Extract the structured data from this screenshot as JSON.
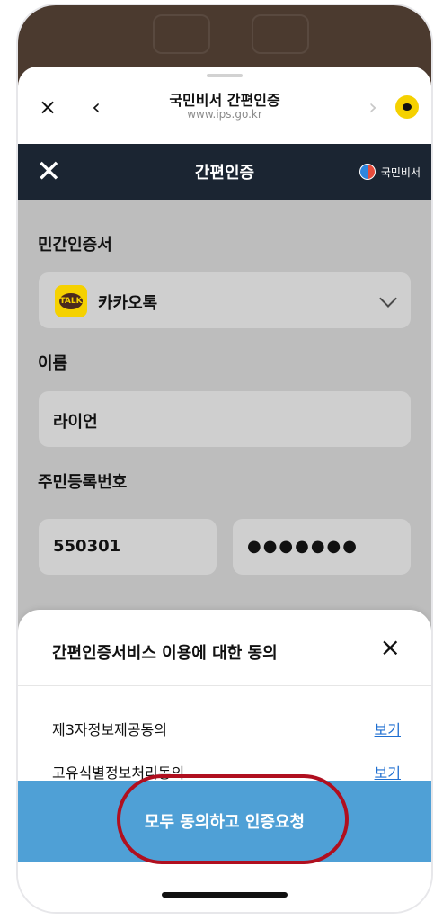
{
  "browser": {
    "close": "×",
    "back": "‹",
    "forward": "›",
    "title": "국민비서 간편인증",
    "url": "www.ips.go.kr"
  },
  "navbar": {
    "close": "✕",
    "title": "간편인증",
    "brand": "국민비서"
  },
  "form": {
    "cert_label": "민간인증서",
    "cert_value": "카카오톡",
    "name_label": "이름",
    "name_value": "라이언",
    "rrn_label": "주민등록번호",
    "rrn_front": "550301",
    "rrn_back": "●●●●●●●"
  },
  "modal": {
    "title": "간편인증서비스 이용에 대한 동의",
    "close": "×",
    "items": [
      {
        "text": "제3자정보제공동의",
        "link": "보기"
      },
      {
        "text": "고유식별정보처리동의",
        "link": "보기"
      }
    ],
    "cta": "모두 동의하고 인증요청"
  },
  "icons": {
    "kakao_talk": "TALK"
  },
  "colors": {
    "navbar": "#1b2532",
    "cta": "#4fa0d6",
    "highlight": "#b00f1f"
  }
}
